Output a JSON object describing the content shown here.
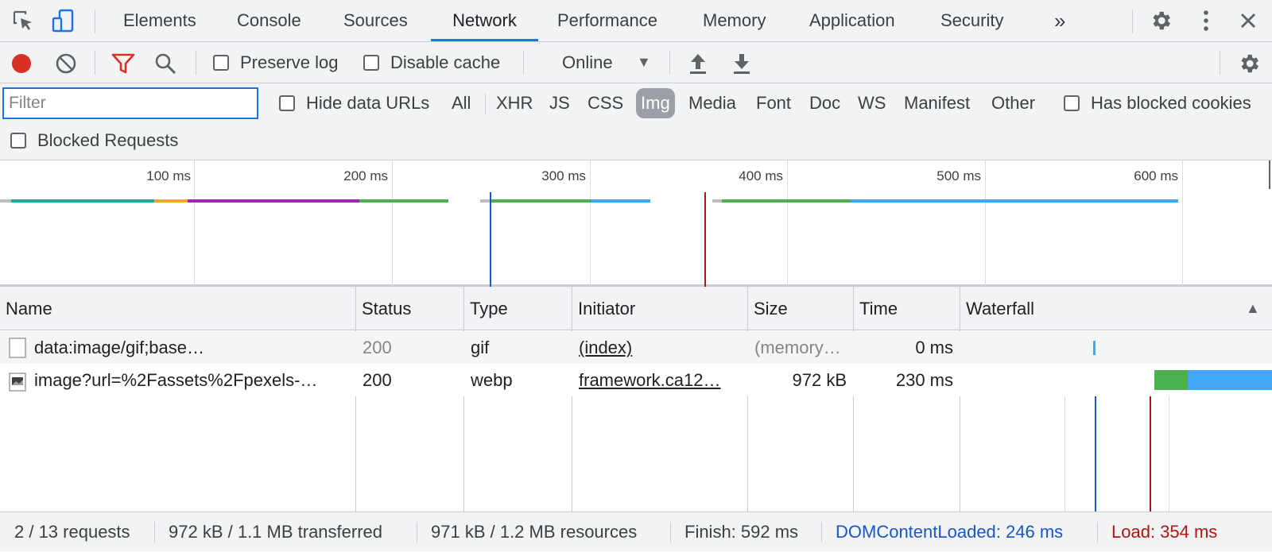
{
  "tabs": [
    {
      "label": "Elements"
    },
    {
      "label": "Console"
    },
    {
      "label": "Sources"
    },
    {
      "label": "Network"
    },
    {
      "label": "Performance"
    },
    {
      "label": "Memory"
    },
    {
      "label": "Application"
    },
    {
      "label": "Security"
    }
  ],
  "active_tab": "Network",
  "tabbar": {
    "more_label": "»"
  },
  "toolbar": {
    "preserve_log_label": "Preserve log",
    "disable_cache_label": "Disable cache",
    "throttling_value": "Online",
    "throttling_arrow": "▼"
  },
  "filter": {
    "placeholder": "Filter",
    "hide_data_urls_label": "Hide data URLs",
    "types": [
      "All",
      "XHR",
      "JS",
      "CSS",
      "Img",
      "Media",
      "Font",
      "Doc",
      "WS",
      "Manifest",
      "Other"
    ],
    "selected_type": "Img",
    "has_blocked_cookies_label": "Has blocked cookies",
    "blocked_requests_label": "Blocked Requests"
  },
  "overview": {
    "tick_labels": [
      "100 ms",
      "200 ms",
      "300 ms",
      "400 ms",
      "500 ms",
      "600 ms"
    ],
    "dom_content_loaded_ms": 246,
    "load_ms": 354
  },
  "table": {
    "columns": [
      "Name",
      "Status",
      "Type",
      "Initiator",
      "Size",
      "Time",
      "Waterfall"
    ],
    "sort_indicator": "▲",
    "rows": [
      {
        "name": "data:image/gif;base…",
        "status": "200",
        "type": "gif",
        "initiator": "(index)",
        "size": "(memory…",
        "time": "0 ms"
      },
      {
        "name": "image?url=%2Fassets%2Fpexels-…",
        "status": "200",
        "type": "webp",
        "initiator": "framework.ca12…",
        "size": "972 kB",
        "time": "230 ms"
      }
    ]
  },
  "status": {
    "requests": "2 / 13 requests",
    "transferred": "972 kB / 1.1 MB transferred",
    "resources": "971 kB / 1.2 MB resources",
    "finish": "Finish: 592 ms",
    "dom_content_loaded": "DOMContentLoaded: 246 ms",
    "load": "Load: 354 ms"
  },
  "colors": {
    "accent": "#1a73e8",
    "record": "#d93025",
    "dom_content_loaded": "#1a56c4",
    "load": "#b31412",
    "waterfall_waiting": "#4caf50",
    "waterfall_download": "#42a5f5"
  },
  "icons": [
    "inspect-element-icon",
    "device-toolbar-icon",
    "settings-icon",
    "kebab-menu-icon",
    "close-icon",
    "record-icon",
    "clear-icon",
    "filter-icon",
    "search-icon",
    "upload-icon",
    "download-icon",
    "network-settings-icon",
    "file-icon",
    "image-file-icon"
  ]
}
